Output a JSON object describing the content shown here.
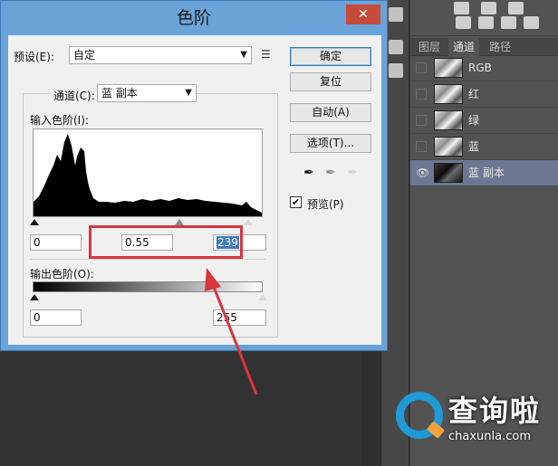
{
  "dialog": {
    "title": "色阶",
    "close_glyph": "✕",
    "preset_label": "预设(E):",
    "preset_value": "自定",
    "channel_label": "通道(C):",
    "channel_value": "蓝 副本",
    "input_levels_label": "输入色阶(I):",
    "input_black": "0",
    "input_gamma": "0.55",
    "input_white": "239",
    "output_levels_label": "输出色阶(O):",
    "output_black": "0",
    "output_white": "255",
    "buttons": {
      "ok": "确定",
      "reset": "复位",
      "auto": "自动(A)",
      "options": "选项(T)..."
    },
    "preview_label": "预览(P)",
    "preview_checked": true
  },
  "panel": {
    "tabs": [
      "图层",
      "通道",
      "路径"
    ],
    "active_tab": "通道",
    "channels": [
      {
        "name": "RGB",
        "visible": false,
        "selected": false
      },
      {
        "name": "红",
        "visible": false,
        "selected": false
      },
      {
        "name": "绿",
        "visible": false,
        "selected": false
      },
      {
        "name": "蓝",
        "visible": false,
        "selected": false
      },
      {
        "name": "蓝 副本",
        "visible": true,
        "selected": true
      }
    ]
  },
  "watermark": {
    "title": "查询啦",
    "url": "chaxunla.com"
  },
  "colors": {
    "annotation_red": "#d9363e",
    "dialog_frame": "#6aa3d8",
    "selected_channel": "#6c7891"
  }
}
